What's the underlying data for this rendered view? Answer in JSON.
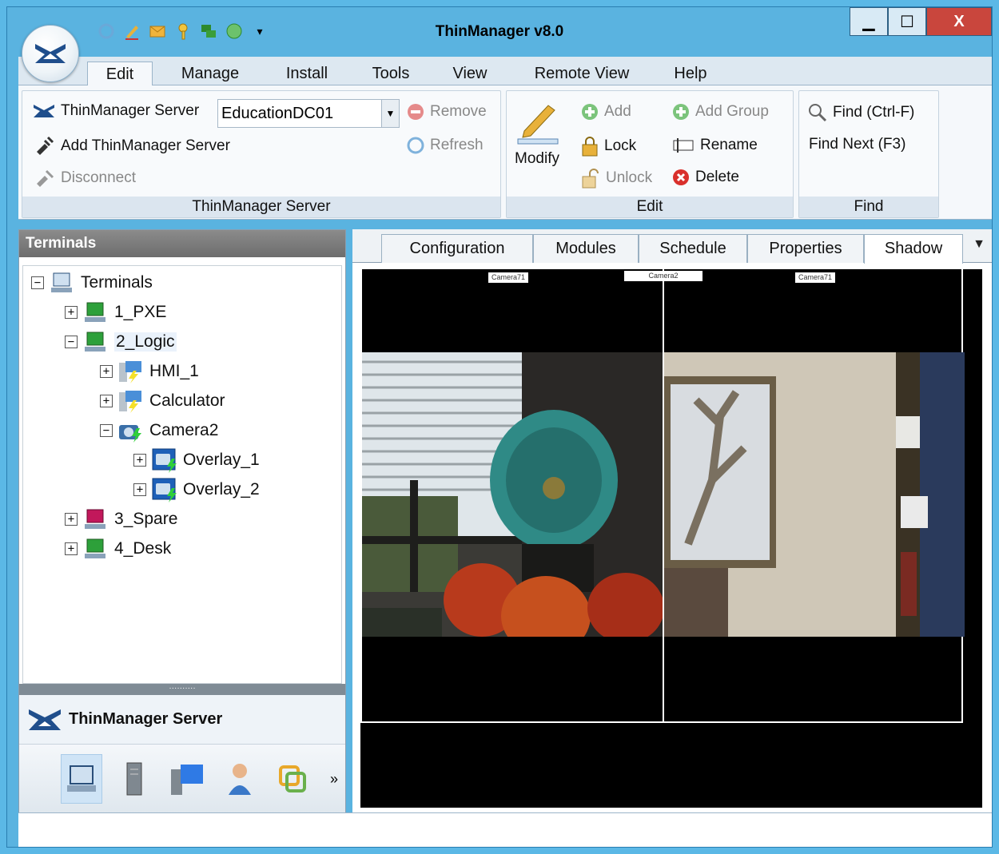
{
  "window": {
    "title": "ThinManager v8.0"
  },
  "window_controls": {
    "minimize": "▁",
    "maximize": "☐",
    "close": "X"
  },
  "ribbon_tabs": [
    "Edit",
    "Manage",
    "Install",
    "Tools",
    "View",
    "Remote View",
    "Help"
  ],
  "active_ribbon_tab": "Edit",
  "groups": {
    "server": {
      "title": "ThinManager Server",
      "server_label": "ThinManager Server",
      "server_value": "EducationDC01",
      "add_server": "Add ThinManager Server",
      "disconnect": "Disconnect",
      "remove": "Remove",
      "refresh": "Refresh"
    },
    "edit": {
      "title": "Edit",
      "modify": "Modify",
      "add": "Add",
      "add_group": "Add Group",
      "lock": "Lock",
      "rename": "Rename",
      "unlock": "Unlock",
      "delete": "Delete"
    },
    "find": {
      "title": "Find",
      "find": "Find (Ctrl-F)",
      "find_next": "Find Next (F3)"
    }
  },
  "left_panel": {
    "title": "Terminals",
    "tree": [
      {
        "label": "Terminals",
        "exp": "−"
      },
      {
        "label": "1_PXE",
        "exp": "+"
      },
      {
        "label": "2_Logic",
        "exp": "−"
      },
      {
        "label": "HMI_1",
        "exp": "+"
      },
      {
        "label": "Calculator",
        "exp": "+"
      },
      {
        "label": "Camera2",
        "exp": "−"
      },
      {
        "label": "Overlay_1",
        "exp": "+"
      },
      {
        "label": "Overlay_2",
        "exp": "+"
      },
      {
        "label": "3_Spare",
        "exp": "+"
      },
      {
        "label": "4_Desk",
        "exp": "+"
      }
    ],
    "splitter_dots": "··········",
    "nav_title": "ThinManager Server",
    "nav_more": "»"
  },
  "content_tabs": [
    "Configuration",
    "Modules",
    "Schedule",
    "Properties",
    "Shadow"
  ],
  "active_content_tab": "Shadow",
  "tab_menu": "▼",
  "viewer": {
    "labels": [
      "Camera71",
      "Camera2",
      "Camera71"
    ]
  },
  "colors": {
    "accent": "#5ab3e0",
    "close_button": "#c9463d",
    "panel_header": "#7a7a7a"
  }
}
